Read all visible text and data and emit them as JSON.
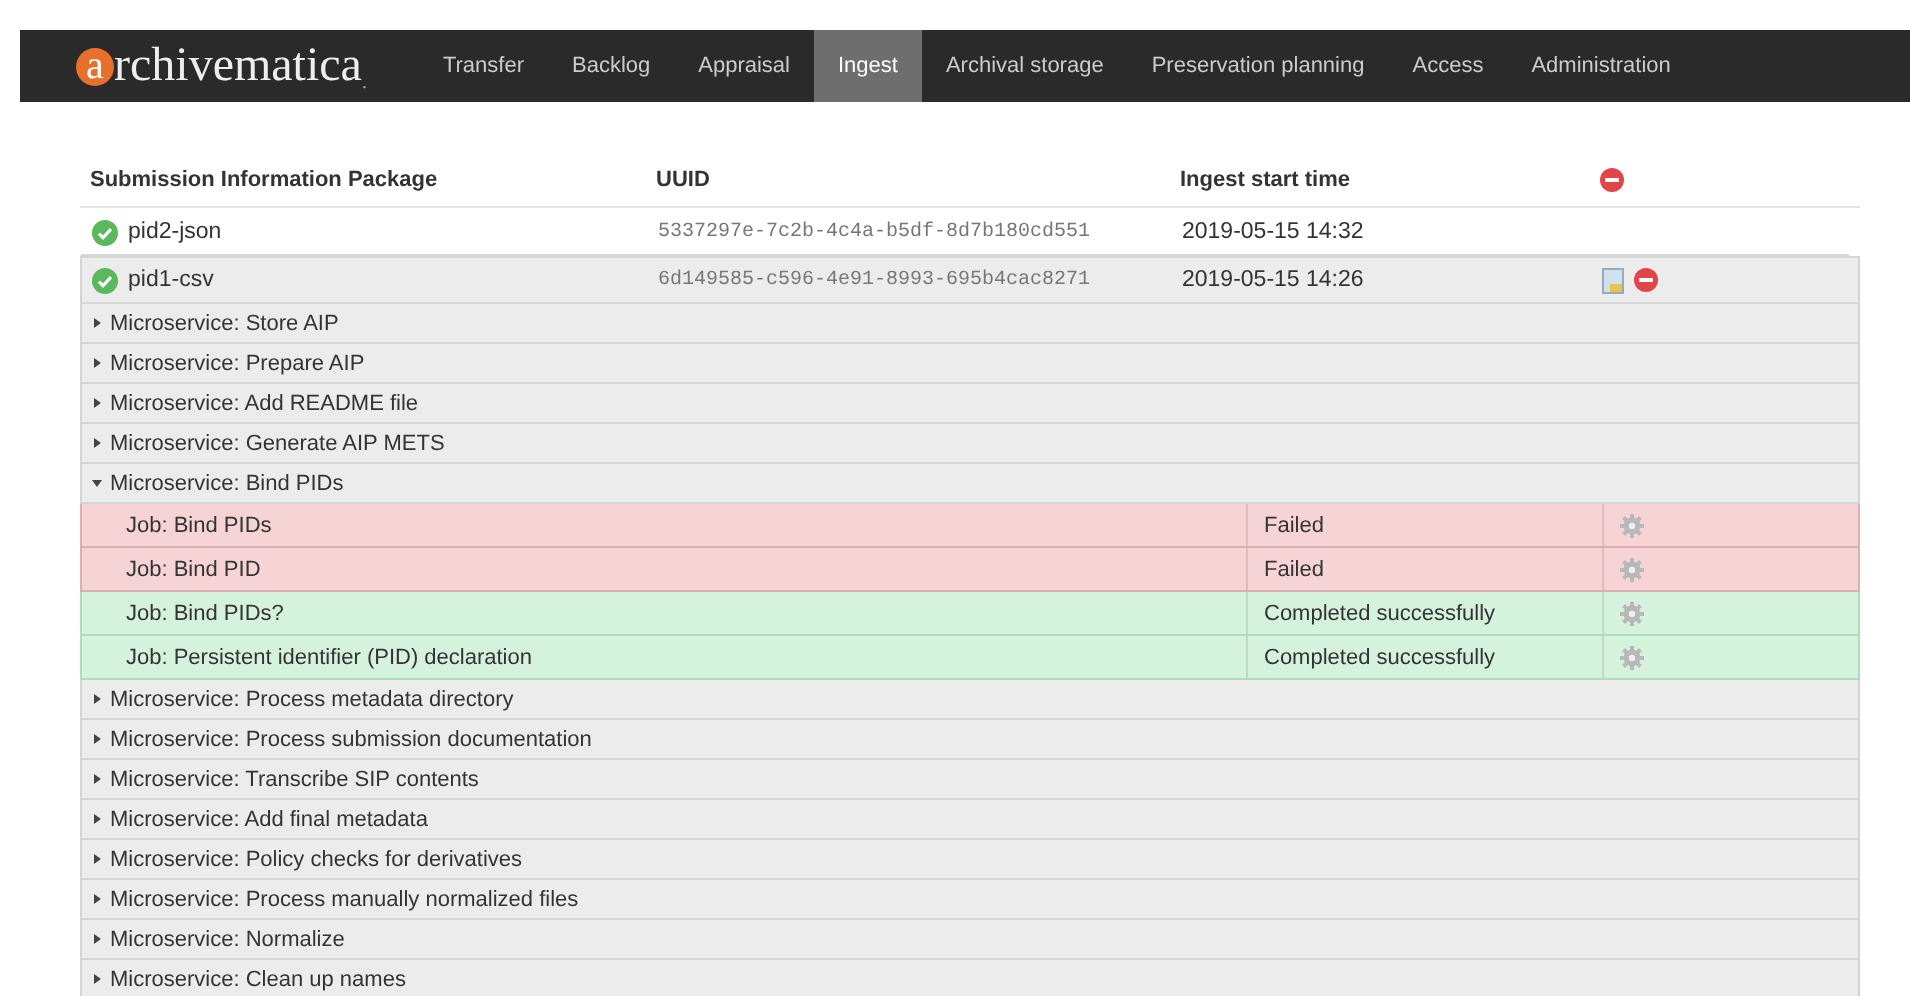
{
  "nav": {
    "logo": "archivematica.",
    "tabs": [
      {
        "label": "Transfer",
        "selected": false
      },
      {
        "label": "Backlog",
        "selected": false
      },
      {
        "label": "Appraisal",
        "selected": false
      },
      {
        "label": "Ingest",
        "selected": true
      },
      {
        "label": "Archival storage",
        "selected": false
      },
      {
        "label": "Preservation planning",
        "selected": false
      },
      {
        "label": "Access",
        "selected": false
      },
      {
        "label": "Administration",
        "selected": false
      }
    ]
  },
  "table": {
    "columns": [
      "Submission Information Package",
      "UUID",
      "Ingest start time"
    ],
    "packages": [
      {
        "name": "pid2-json",
        "uuid": "5337297e-7c2b-4c4a-b5df-8d7b180cd551",
        "start_time": "2019-05-15 14:32",
        "expanded": false
      },
      {
        "name": "pid1-csv",
        "uuid": "6d149585-c596-4e91-8993-695b4cac8271",
        "start_time": "2019-05-15 14:26",
        "expanded": true,
        "microservices": [
          {
            "label": "Microservice: Store AIP",
            "expanded": false
          },
          {
            "label": "Microservice: Prepare AIP",
            "expanded": false
          },
          {
            "label": "Microservice: Add README file",
            "expanded": false
          },
          {
            "label": "Microservice: Generate AIP METS",
            "expanded": false
          },
          {
            "label": "Microservice: Bind PIDs",
            "expanded": true,
            "jobs": [
              {
                "label": "Job: Bind PIDs",
                "status": "Failed",
                "failed": true
              },
              {
                "label": "Job: Bind PID",
                "status": "Failed",
                "failed": true
              },
              {
                "label": "Job: Bind PIDs?",
                "status": "Completed successfully",
                "failed": false
              },
              {
                "label": "Job: Persistent identifier (PID) declaration",
                "status": "Completed successfully",
                "failed": false
              }
            ]
          },
          {
            "label": "Microservice: Process metadata directory",
            "expanded": false
          },
          {
            "label": "Microservice: Process submission documentation",
            "expanded": false
          },
          {
            "label": "Microservice: Transcribe SIP contents",
            "expanded": false
          },
          {
            "label": "Microservice: Add final metadata",
            "expanded": false
          },
          {
            "label": "Microservice: Policy checks for derivatives",
            "expanded": false
          },
          {
            "label": "Microservice: Process manually normalized files",
            "expanded": false
          },
          {
            "label": "Microservice: Normalize",
            "expanded": false
          },
          {
            "label": "Microservice: Clean up names",
            "expanded": false
          }
        ]
      }
    ]
  }
}
